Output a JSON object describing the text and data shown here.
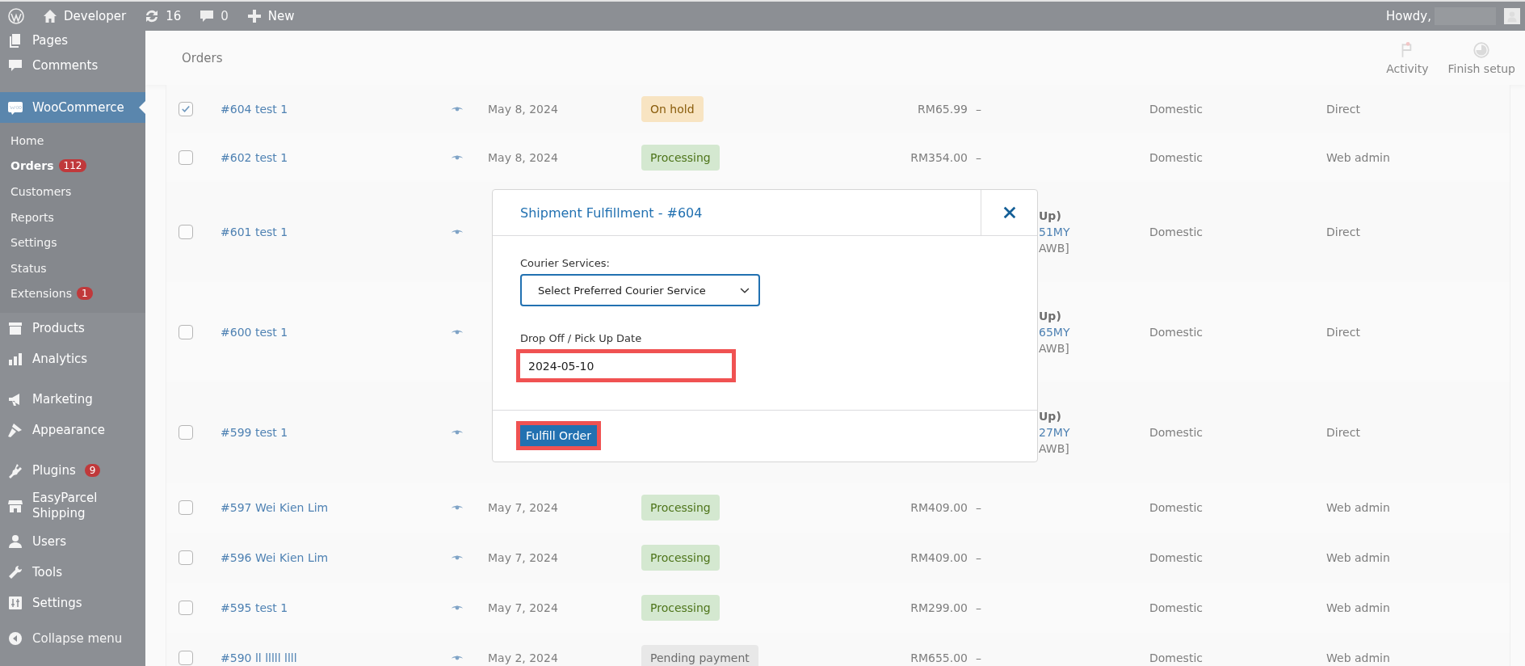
{
  "admin_bar": {
    "site": "Developer",
    "updates": "16",
    "comments": "0",
    "new": "New",
    "greeting": "Howdy,"
  },
  "sidebar": {
    "items": [
      {
        "label": "Pages",
        "selected": false
      },
      {
        "label": "Comments",
        "selected": false
      },
      {
        "label": "WooCommerce",
        "selected": true,
        "children": [
          {
            "label": "Home",
            "selected": false
          },
          {
            "label": "Orders",
            "selected": true,
            "badge": "112"
          },
          {
            "label": "Customers",
            "selected": false
          },
          {
            "label": "Reports",
            "selected": false
          },
          {
            "label": "Settings",
            "selected": false
          },
          {
            "label": "Status",
            "selected": false
          },
          {
            "label": "Extensions",
            "selected": false,
            "badge": "1"
          }
        ]
      },
      {
        "label": "Products",
        "selected": false
      },
      {
        "label": "Analytics",
        "selected": false
      },
      {
        "label": "Marketing",
        "selected": false
      },
      {
        "label": "Appearance",
        "selected": false
      },
      {
        "label": "Plugins",
        "selected": false,
        "badge": "9"
      },
      {
        "label": "EasyParcel Shipping",
        "selected": false
      },
      {
        "label": "Users",
        "selected": false
      },
      {
        "label": "Tools",
        "selected": false
      },
      {
        "label": "Settings",
        "selected": false
      },
      {
        "label": "Collapse menu",
        "selected": false
      }
    ]
  },
  "page_header": {
    "title": "Orders",
    "actions": [
      {
        "label": "Activity"
      },
      {
        "label": "Finish setup"
      }
    ]
  },
  "orders": {
    "rows": [
      {
        "checked": true,
        "order": "#604 test 1",
        "date": "May 8, 2024",
        "status": {
          "label": "On hold",
          "kind": "on-hold"
        },
        "total": "RM65.99",
        "column_6": [
          "–"
        ],
        "column_7": "Domestic",
        "column_8": "Direct"
      },
      {
        "checked": false,
        "order": "#602 test 1",
        "date": "May 8, 2024",
        "status": {
          "label": "Processing",
          "kind": "processing"
        },
        "total": "RM354.00",
        "column_6": [
          "–"
        ],
        "column_7": "Domestic",
        "column_8": "Web admin"
      },
      {
        "checked": false,
        "order": "#601 test 1",
        "column_6": [
          "Up)",
          "51MY",
          "AWB]"
        ],
        "column_7": "Domestic",
        "column_8": "Direct"
      },
      {
        "checked": false,
        "order": "#600 test 1",
        "column_6": [
          "Up)",
          "65MY",
          "AWB]"
        ],
        "column_7": "Domestic",
        "column_8": "Direct"
      },
      {
        "checked": false,
        "order": "#599 test 1",
        "column_6": [
          "Up)",
          "27MY",
          "AWB]"
        ],
        "column_7": "Domestic",
        "column_8": "Direct"
      },
      {
        "checked": false,
        "order": "#597 Wei Kien Lim",
        "date": "May 7, 2024",
        "status": {
          "label": "Processing",
          "kind": "processing"
        },
        "total": "RM409.00",
        "column_6": [
          "–"
        ],
        "column_7": "Domestic",
        "column_8": "Web admin"
      },
      {
        "checked": false,
        "order": "#596 Wei Kien Lim",
        "date": "May 7, 2024",
        "status": {
          "label": "Processing",
          "kind": "processing"
        },
        "total": "RM409.00",
        "column_6": [
          "–"
        ],
        "column_7": "Domestic",
        "column_8": "Web admin"
      },
      {
        "checked": false,
        "order": "#595 test 1",
        "date": "May 7, 2024",
        "status": {
          "label": "Processing",
          "kind": "processing"
        },
        "total": "RM299.00",
        "column_6": [
          "–"
        ],
        "column_7": "Domestic",
        "column_8": "Web admin"
      },
      {
        "checked": false,
        "order": "#590 ll lllll llll",
        "date": "May 2, 2024",
        "status": {
          "label": "Pending payment",
          "kind": "pending"
        },
        "total": "RM655.00",
        "column_6": [
          "–"
        ],
        "column_7": "Domestic",
        "column_8": "Web admin"
      }
    ]
  },
  "modal": {
    "title": "Shipment Fulfillment - #604",
    "courier": {
      "label": "Courier Services:",
      "placeholder": "Select Preferred Courier Service"
    },
    "date": {
      "label": "Drop Off / Pick Up Date",
      "value": "2024-05-10",
      "highlighted": true
    },
    "button": {
      "label": "Fulfill Order",
      "highlighted": true
    }
  }
}
